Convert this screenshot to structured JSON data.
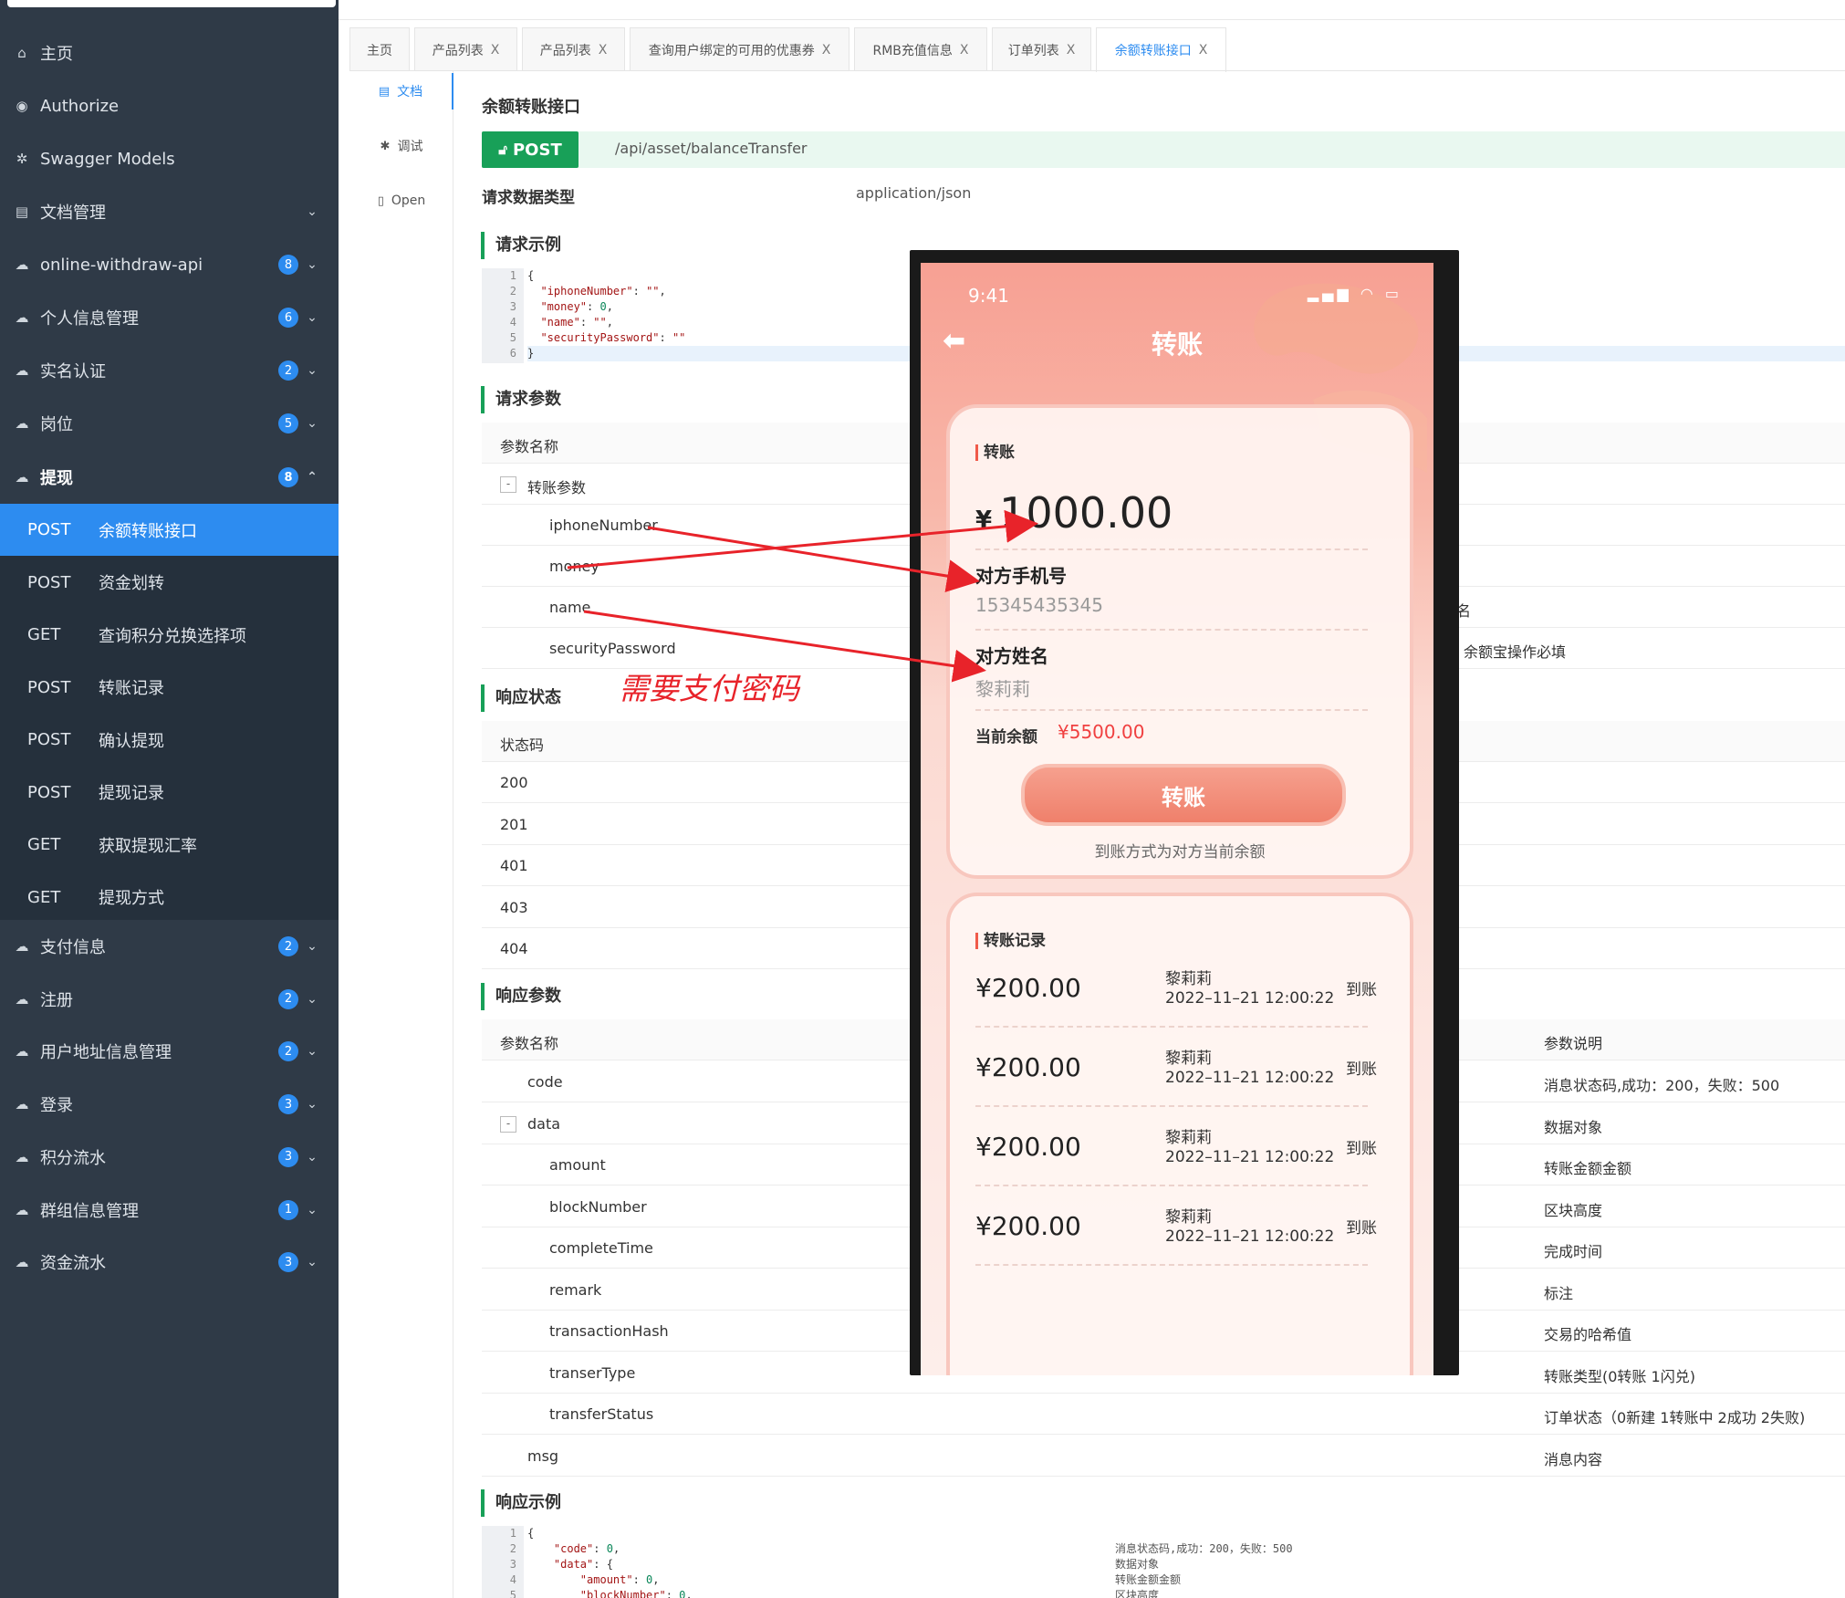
{
  "sidebar": {
    "items": [
      {
        "icon": "home-icon",
        "glyph": "⌂",
        "label": "主页",
        "badge": "",
        "chevron": ""
      },
      {
        "icon": "lock-icon",
        "glyph": "◉",
        "label": "Authorize",
        "badge": "",
        "chevron": ""
      },
      {
        "icon": "gear-icon",
        "glyph": "✲",
        "label": "Swagger Models",
        "badge": "",
        "chevron": ""
      },
      {
        "icon": "doc-icon",
        "glyph": "▤",
        "label": "文档管理",
        "badge": "",
        "chevron": "⌄"
      },
      {
        "icon": "cloud-icon",
        "glyph": "☁",
        "label": "online-withdraw-api",
        "badge": "8",
        "chevron": "⌄"
      },
      {
        "icon": "cloud-icon",
        "glyph": "☁",
        "label": "个人信息管理",
        "badge": "6",
        "chevron": "⌄"
      },
      {
        "icon": "cloud-icon",
        "glyph": "☁",
        "label": "实名认证",
        "badge": "2",
        "chevron": "⌄"
      },
      {
        "icon": "cloud-icon",
        "glyph": "☁",
        "label": "岗位",
        "badge": "5",
        "chevron": "⌄"
      },
      {
        "icon": "cloud-icon",
        "glyph": "☁",
        "label": "提现",
        "badge": "8",
        "chevron": "⌃"
      }
    ],
    "sub_items": [
      {
        "method": "POST",
        "label": "余额转账接口"
      },
      {
        "method": "POST",
        "label": "资金划转"
      },
      {
        "method": "GET",
        "label": "查询积分兑换选择项"
      },
      {
        "method": "POST",
        "label": "转账记录"
      },
      {
        "method": "POST",
        "label": "确认提现"
      },
      {
        "method": "POST",
        "label": "提现记录"
      },
      {
        "method": "GET",
        "label": "获取提现汇率"
      },
      {
        "method": "GET",
        "label": "提现方式"
      }
    ],
    "lower_items": [
      {
        "icon": "cloud-icon",
        "glyph": "☁",
        "label": "支付信息",
        "badge": "2",
        "chevron": "⌄"
      },
      {
        "icon": "cloud-icon",
        "glyph": "☁",
        "label": "注册",
        "badge": "2",
        "chevron": "⌄"
      },
      {
        "icon": "cloud-icon",
        "glyph": "☁",
        "label": "用户地址信息管理",
        "badge": "2",
        "chevron": "⌄"
      },
      {
        "icon": "cloud-icon",
        "glyph": "☁",
        "label": "登录",
        "badge": "3",
        "chevron": "⌄"
      },
      {
        "icon": "cloud-icon",
        "glyph": "☁",
        "label": "积分流水",
        "badge": "3",
        "chevron": "⌄"
      },
      {
        "icon": "cloud-icon",
        "glyph": "☁",
        "label": "群组信息管理",
        "badge": "1",
        "chevron": "⌄"
      },
      {
        "icon": "cloud-icon",
        "glyph": "☁",
        "label": "资金流水",
        "badge": "3",
        "chevron": "⌄"
      }
    ]
  },
  "tabs": [
    {
      "label": "主页",
      "close": ""
    },
    {
      "label": "产品列表",
      "close": "X"
    },
    {
      "label": "产品列表",
      "close": "X"
    },
    {
      "label": "查询用户绑定的可用的优惠券",
      "close": "X"
    },
    {
      "label": "RMB充值信息",
      "close": "X"
    },
    {
      "label": "订单列表",
      "close": "X"
    },
    {
      "label": "余额转账接口",
      "close": "X"
    }
  ],
  "mini_nav": [
    {
      "icon": "doc-icon",
      "glyph": "▤",
      "label": "文档"
    },
    {
      "icon": "bug-icon",
      "glyph": "✱",
      "label": "调试"
    },
    {
      "icon": "file-icon",
      "glyph": "▯",
      "label": "Open"
    }
  ],
  "doc": {
    "title": "余额转账接口",
    "method": "POST",
    "method_icon": "unlock-icon",
    "url": "/api/asset/balanceTransfer",
    "content_type_label": "请求数据类型",
    "content_type": "application/json",
    "request_example_title": "请求示例",
    "request_example_lines": [
      "1",
      "2",
      "3",
      "4",
      "5",
      "6"
    ],
    "request_params_title": "请求参数",
    "param_name_header": "参数名称",
    "transfer_params": "转账参数",
    "params": [
      "iphoneNumber",
      "money",
      "name",
      "securityPassword"
    ],
    "param_right_fragments": [
      "名",
      "余额宝操作必填"
    ],
    "response_status_title": "响应状态",
    "status_header": "状态码",
    "statuses": [
      "200",
      "201",
      "401",
      "403",
      "404"
    ],
    "response_params_title": "响应参数",
    "resp_param_header": "参数名称",
    "resp_desc_header": "参数说明",
    "resp_params": [
      {
        "name": "code",
        "desc": "消息状态码,成功：200，失败：500",
        "indent": 1
      },
      {
        "name": "data",
        "desc": "数据对象",
        "indent": 1
      },
      {
        "name": "amount",
        "desc": "转账金额金额",
        "indent": 2
      },
      {
        "name": "blockNumber",
        "desc": "区块高度",
        "indent": 2
      },
      {
        "name": "completeTime",
        "desc": "完成时间",
        "indent": 2
      },
      {
        "name": "remark",
        "desc": "标注",
        "indent": 2
      },
      {
        "name": "transactionHash",
        "desc": "交易的哈希值",
        "indent": 2
      },
      {
        "name": "transerType",
        "desc": "转账类型(0转账 1闪兑)",
        "indent": 2
      },
      {
        "name": "transferStatus",
        "desc": "订单状态（0新建 1转账中 2成功 2失败)",
        "indent": 2
      },
      {
        "name": "msg",
        "desc": "消息内容",
        "indent": 1
      }
    ],
    "response_example_title": "响应示例",
    "response_example_lines": [
      "1",
      "2",
      "3",
      "4",
      "5"
    ],
    "response_example_desc": [
      "消息状态码,成功：200，失败：500",
      "数据对象",
      "转账金额金额",
      "区块高度"
    ]
  },
  "phone": {
    "time": "9:41",
    "status_icons": "signal-wifi-battery-icon",
    "title": "转账",
    "back_icon": "back-arrow-icon",
    "card_title": "转账",
    "currency": "¥",
    "amount": "1000.00",
    "phone_label": "对方手机号",
    "phone_value": "15345435345",
    "name_label": "对方姓名",
    "name_value": "黎莉莉",
    "balance_label": "当前余额",
    "balance_value": "¥5500.00",
    "button": "转账",
    "note": "到账方式为对方当前余额",
    "records_title": "转账记录",
    "records": [
      {
        "amount": "¥200.00",
        "name": "黎莉莉",
        "time": "2022–11–21 12:00:22",
        "status": "到账"
      },
      {
        "amount": "¥200.00",
        "name": "黎莉莉",
        "time": "2022–11–21 12:00:22",
        "status": "到账"
      },
      {
        "amount": "¥200.00",
        "name": "黎莉莉",
        "time": "2022–11–21 12:00:22",
        "status": "到账"
      },
      {
        "amount": "¥200.00",
        "name": "黎莉莉",
        "time": "2022–11–21 12:00:22",
        "status": "到账"
      }
    ]
  },
  "annotation": {
    "text": "需要支付密码",
    "color": "#e8232a"
  },
  "colors": {
    "sidebar_bg": "#2f3a47",
    "active_blue": "#2d8cf0",
    "post_green": "#18a058",
    "phone_accent": "#f04040"
  }
}
